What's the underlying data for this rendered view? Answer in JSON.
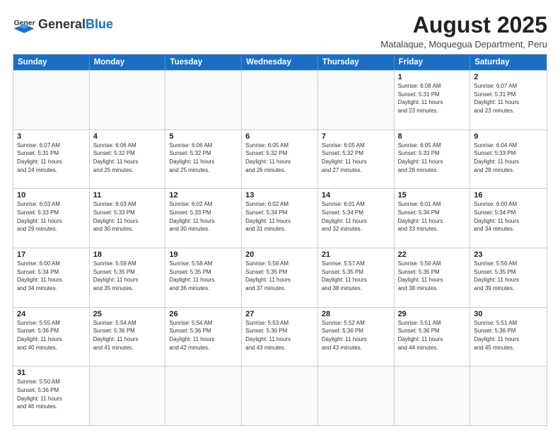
{
  "header": {
    "logo_general": "General",
    "logo_blue": "Blue",
    "month_title": "August 2025",
    "subtitle": "Matalaque, Moquegua Department, Peru"
  },
  "weekdays": [
    "Sunday",
    "Monday",
    "Tuesday",
    "Wednesday",
    "Thursday",
    "Friday",
    "Saturday"
  ],
  "rows": [
    [
      {
        "day": "",
        "info": ""
      },
      {
        "day": "",
        "info": ""
      },
      {
        "day": "",
        "info": ""
      },
      {
        "day": "",
        "info": ""
      },
      {
        "day": "",
        "info": ""
      },
      {
        "day": "1",
        "info": "Sunrise: 6:08 AM\nSunset: 5:31 PM\nDaylight: 11 hours\nand 23 minutes."
      },
      {
        "day": "2",
        "info": "Sunrise: 6:07 AM\nSunset: 5:31 PM\nDaylight: 11 hours\nand 23 minutes."
      }
    ],
    [
      {
        "day": "3",
        "info": "Sunrise: 6:07 AM\nSunset: 5:31 PM\nDaylight: 11 hours\nand 24 minutes."
      },
      {
        "day": "4",
        "info": "Sunrise: 6:06 AM\nSunset: 5:32 PM\nDaylight: 11 hours\nand 25 minutes."
      },
      {
        "day": "5",
        "info": "Sunrise: 6:06 AM\nSunset: 5:32 PM\nDaylight: 11 hours\nand 25 minutes."
      },
      {
        "day": "6",
        "info": "Sunrise: 6:05 AM\nSunset: 5:32 PM\nDaylight: 11 hours\nand 26 minutes."
      },
      {
        "day": "7",
        "info": "Sunrise: 6:05 AM\nSunset: 5:32 PM\nDaylight: 11 hours\nand 27 minutes."
      },
      {
        "day": "8",
        "info": "Sunrise: 6:05 AM\nSunset: 5:33 PM\nDaylight: 11 hours\nand 28 minutes."
      },
      {
        "day": "9",
        "info": "Sunrise: 6:04 AM\nSunset: 5:33 PM\nDaylight: 11 hours\nand 28 minutes."
      }
    ],
    [
      {
        "day": "10",
        "info": "Sunrise: 6:03 AM\nSunset: 5:33 PM\nDaylight: 11 hours\nand 29 minutes."
      },
      {
        "day": "11",
        "info": "Sunrise: 6:03 AM\nSunset: 5:33 PM\nDaylight: 11 hours\nand 30 minutes."
      },
      {
        "day": "12",
        "info": "Sunrise: 6:02 AM\nSunset: 5:33 PM\nDaylight: 11 hours\nand 30 minutes."
      },
      {
        "day": "13",
        "info": "Sunrise: 6:02 AM\nSunset: 5:34 PM\nDaylight: 11 hours\nand 31 minutes."
      },
      {
        "day": "14",
        "info": "Sunrise: 6:01 AM\nSunset: 5:34 PM\nDaylight: 11 hours\nand 32 minutes."
      },
      {
        "day": "15",
        "info": "Sunrise: 6:01 AM\nSunset: 5:34 PM\nDaylight: 11 hours\nand 33 minutes."
      },
      {
        "day": "16",
        "info": "Sunrise: 6:00 AM\nSunset: 5:34 PM\nDaylight: 11 hours\nand 34 minutes."
      }
    ],
    [
      {
        "day": "17",
        "info": "Sunrise: 6:00 AM\nSunset: 5:34 PM\nDaylight: 11 hours\nand 34 minutes."
      },
      {
        "day": "18",
        "info": "Sunrise: 5:59 AM\nSunset: 5:35 PM\nDaylight: 11 hours\nand 35 minutes."
      },
      {
        "day": "19",
        "info": "Sunrise: 5:58 AM\nSunset: 5:35 PM\nDaylight: 11 hours\nand 36 minutes."
      },
      {
        "day": "20",
        "info": "Sunrise: 5:58 AM\nSunset: 5:35 PM\nDaylight: 11 hours\nand 37 minutes."
      },
      {
        "day": "21",
        "info": "Sunrise: 5:57 AM\nSunset: 5:35 PM\nDaylight: 11 hours\nand 38 minutes."
      },
      {
        "day": "22",
        "info": "Sunrise: 5:56 AM\nSunset: 5:35 PM\nDaylight: 11 hours\nand 38 minutes."
      },
      {
        "day": "23",
        "info": "Sunrise: 5:56 AM\nSunset: 5:35 PM\nDaylight: 11 hours\nand 39 minutes."
      }
    ],
    [
      {
        "day": "24",
        "info": "Sunrise: 5:55 AM\nSunset: 5:36 PM\nDaylight: 11 hours\nand 40 minutes."
      },
      {
        "day": "25",
        "info": "Sunrise: 5:54 AM\nSunset: 5:36 PM\nDaylight: 11 hours\nand 41 minutes."
      },
      {
        "day": "26",
        "info": "Sunrise: 5:54 AM\nSunset: 5:36 PM\nDaylight: 11 hours\nand 42 minutes."
      },
      {
        "day": "27",
        "info": "Sunrise: 5:53 AM\nSunset: 5:36 PM\nDaylight: 11 hours\nand 43 minutes."
      },
      {
        "day": "28",
        "info": "Sunrise: 5:52 AM\nSunset: 5:36 PM\nDaylight: 11 hours\nand 43 minutes."
      },
      {
        "day": "29",
        "info": "Sunrise: 5:51 AM\nSunset: 5:36 PM\nDaylight: 11 hours\nand 44 minutes."
      },
      {
        "day": "30",
        "info": "Sunrise: 5:51 AM\nSunset: 5:36 PM\nDaylight: 11 hours\nand 45 minutes."
      }
    ],
    [
      {
        "day": "31",
        "info": "Sunrise: 5:50 AM\nSunset: 5:36 PM\nDaylight: 11 hours\nand 46 minutes."
      },
      {
        "day": "",
        "info": ""
      },
      {
        "day": "",
        "info": ""
      },
      {
        "day": "",
        "info": ""
      },
      {
        "day": "",
        "info": ""
      },
      {
        "day": "",
        "info": ""
      },
      {
        "day": "",
        "info": ""
      }
    ]
  ]
}
